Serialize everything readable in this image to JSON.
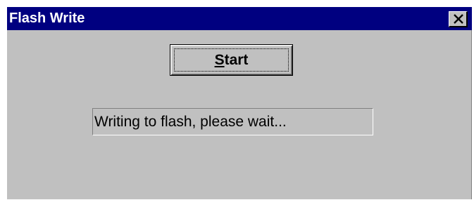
{
  "window": {
    "title": "Flash Write",
    "close_icon": "close-x-icon"
  },
  "actions": {
    "start": {
      "accelerator": "S",
      "rest": "tart"
    }
  },
  "status": {
    "message": "Writing to flash, please wait..."
  },
  "colors": {
    "titlebar": "#000080",
    "face": "#c0c0c0",
    "title_text": "#ffffff"
  }
}
